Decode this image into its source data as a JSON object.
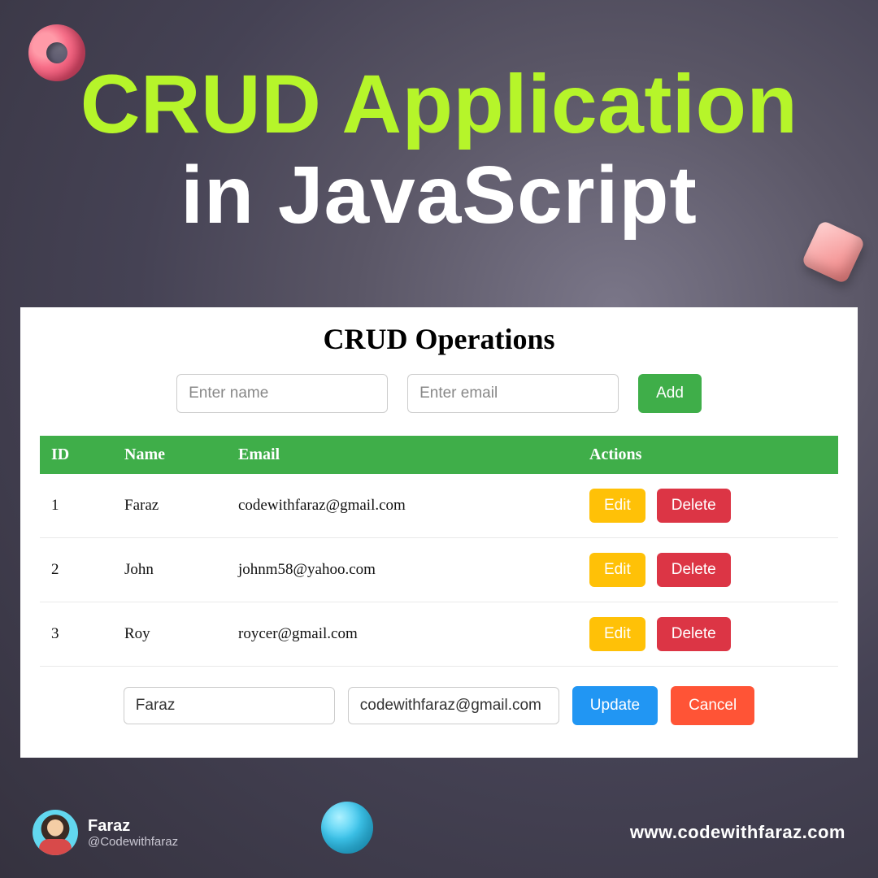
{
  "hero": {
    "line1": "CRUD Application",
    "line2": "in JavaScript"
  },
  "panel": {
    "heading": "CRUD Operations",
    "name_placeholder": "Enter name",
    "email_placeholder": "Enter email",
    "add_label": "Add",
    "columns": {
      "id": "ID",
      "name": "Name",
      "email": "Email",
      "actions": "Actions"
    },
    "rows": [
      {
        "id": "1",
        "name": "Faraz",
        "email": "codewithfaraz@gmail.com"
      },
      {
        "id": "2",
        "name": "John",
        "email": "johnm58@yahoo.com"
      },
      {
        "id": "3",
        "name": "Roy",
        "email": "roycer@gmail.com"
      }
    ],
    "row_buttons": {
      "edit": "Edit",
      "delete": "Delete"
    },
    "edit_form": {
      "name_value": "Faraz",
      "email_value": "codewithfaraz@gmail.com",
      "update_label": "Update",
      "cancel_label": "Cancel"
    }
  },
  "footer": {
    "author_name": "Faraz",
    "author_handle": "@Codewithfaraz",
    "site": "www.codewithfaraz.com"
  },
  "colors": {
    "accent_green": "#3fae49",
    "accent_yellow": "#ffc107",
    "accent_red": "#dc3545",
    "accent_blue": "#2196f3",
    "accent_orange": "#ff5436",
    "hero_green": "#b6f52a"
  }
}
